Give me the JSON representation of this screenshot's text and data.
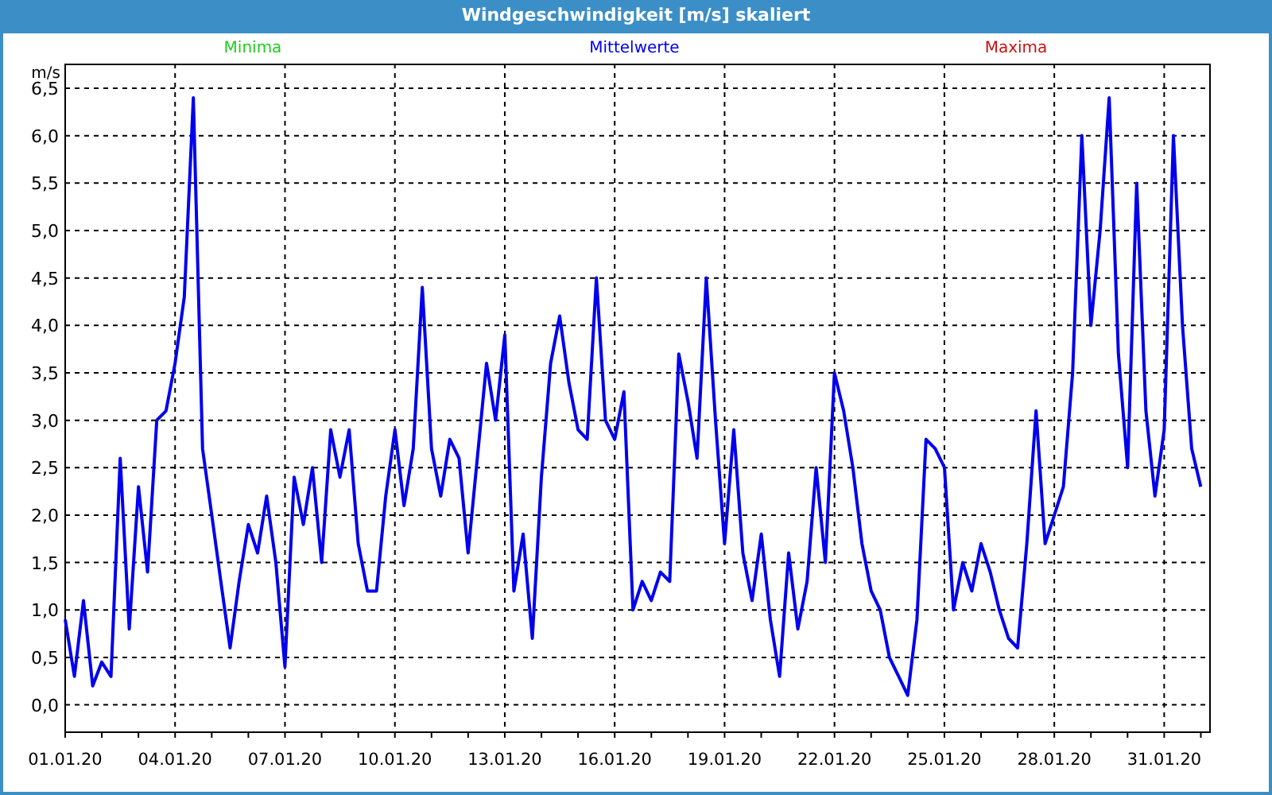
{
  "window": {
    "title": "Windgeschwindigkeit [m/s] skaliert"
  },
  "legend": [
    {
      "label": "Minima",
      "color": "#22cc22"
    },
    {
      "label": "Maxima",
      "color": "#cc1111"
    }
  ],
  "chart_data": {
    "type": "line",
    "grid": true,
    "ylabel": "m/s",
    "ylim": [
      -0.28,
      6.76
    ],
    "categories": [
      "01.01.20",
      null,
      null,
      null,
      null,
      null,
      null,
      null,
      null,
      null,
      null,
      null,
      "04.01.20",
      null,
      null,
      null,
      null,
      null,
      null,
      null,
      null,
      null,
      null,
      null,
      "07.01.20",
      null,
      null,
      null,
      null,
      null,
      null,
      null,
      null,
      null,
      null,
      null,
      "10.01.20",
      null,
      null,
      null,
      null,
      null,
      null,
      null,
      null,
      null,
      null,
      null,
      "13.01.20",
      null,
      null,
      null,
      null,
      null,
      null,
      null,
      null,
      null,
      null,
      null,
      "16.01.20",
      null,
      null,
      null,
      null,
      null,
      null,
      null,
      null,
      null,
      null,
      null,
      "19.01.20",
      null,
      null,
      null,
      null,
      null,
      null,
      null,
      null,
      null,
      null,
      null,
      "22.01.20",
      null,
      null,
      null,
      null,
      null,
      null,
      null,
      null,
      null,
      null,
      null,
      "25.01.20",
      null,
      null,
      null,
      null,
      null,
      null,
      null,
      null,
      null,
      null,
      null,
      "28.01.20",
      null,
      null,
      null,
      null,
      null,
      null,
      null,
      null,
      null,
      null,
      null,
      "31.01.20",
      null,
      null,
      null,
      null
    ],
    "series": [
      {
        "name": "Mittelwerte",
        "color": "#0000ee",
        "values": [
          0.9,
          0.3,
          1.1,
          0.2,
          0.45,
          0.3,
          2.6,
          0.8,
          2.3,
          1.4,
          3.0,
          3.1,
          3.6,
          4.3,
          6.4,
          2.7,
          2.0,
          1.3,
          0.6,
          1.3,
          1.9,
          1.6,
          2.2,
          1.5,
          0.4,
          2.4,
          1.9,
          2.5,
          1.5,
          2.9,
          2.4,
          2.9,
          1.7,
          1.2,
          1.2,
          2.2,
          2.9,
          2.1,
          2.7,
          4.4,
          2.7,
          2.2,
          2.8,
          2.6,
          1.6,
          2.6,
          3.6,
          3.0,
          3.9,
          1.2,
          1.8,
          0.7,
          2.4,
          3.6,
          4.1,
          3.4,
          2.9,
          2.8,
          4.5,
          3.0,
          2.8,
          3.3,
          1.0,
          1.3,
          1.1,
          1.4,
          1.3,
          3.7,
          3.2,
          2.6,
          4.5,
          3.0,
          1.7,
          2.9,
          1.6,
          1.1,
          1.8,
          0.9,
          0.3,
          1.6,
          0.8,
          1.3,
          2.5,
          1.5,
          3.5,
          3.1,
          2.5,
          1.7,
          1.2,
          1.0,
          0.5,
          0.3,
          0.1,
          0.9,
          2.8,
          2.7,
          2.5,
          1.0,
          1.5,
          1.2,
          1.7,
          1.4,
          1.0,
          0.7,
          0.6,
          1.7,
          3.1,
          1.7,
          2.0,
          2.3,
          3.5,
          6.0,
          4.0,
          5.0,
          6.4,
          3.7,
          2.5,
          5.5,
          3.1,
          2.2,
          2.9,
          6.0,
          4.0,
          2.7,
          2.3
        ]
      }
    ],
    "yticks": [
      {
        "value": 0,
        "label": "0,0"
      },
      {
        "value": 0.5,
        "label": "0,5"
      },
      {
        "value": 1,
        "label": "1,0"
      },
      {
        "value": 1.5,
        "label": "1,5"
      },
      {
        "value": 2,
        "label": "2,0"
      },
      {
        "value": 2.5,
        "label": "2,5"
      },
      {
        "value": 3,
        "label": "3,0"
      },
      {
        "value": 3.5,
        "label": "3,5"
      },
      {
        "value": 4,
        "label": "4,0"
      },
      {
        "value": 4.5,
        "label": "4,5"
      },
      {
        "value": 5,
        "label": "5,0"
      },
      {
        "value": 5.5,
        "label": "5,5"
      },
      {
        "value": 6,
        "label": "6,0"
      },
      {
        "value": 6.5,
        "label": "6,5"
      }
    ]
  }
}
